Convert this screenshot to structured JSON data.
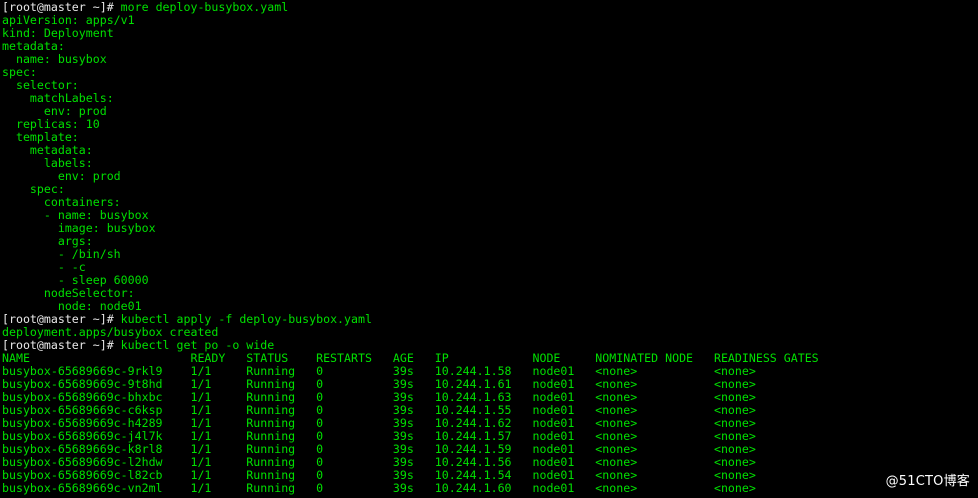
{
  "terminal": {
    "lines": [
      {
        "prompt": "[root@master ~]# ",
        "text": "more deploy-busybox.yaml"
      },
      {
        "prompt": "",
        "text": "apiVersion: apps/v1"
      },
      {
        "prompt": "",
        "text": "kind: Deployment"
      },
      {
        "prompt": "",
        "text": "metadata:"
      },
      {
        "prompt": "",
        "text": "  name: busybox"
      },
      {
        "prompt": "",
        "text": "spec:"
      },
      {
        "prompt": "",
        "text": "  selector:"
      },
      {
        "prompt": "",
        "text": "    matchLabels:"
      },
      {
        "prompt": "",
        "text": "      env: prod"
      },
      {
        "prompt": "",
        "text": "  replicas: 10"
      },
      {
        "prompt": "",
        "text": "  template:"
      },
      {
        "prompt": "",
        "text": "    metadata:"
      },
      {
        "prompt": "",
        "text": "      labels:"
      },
      {
        "prompt": "",
        "text": "        env: prod"
      },
      {
        "prompt": "",
        "text": "    spec:"
      },
      {
        "prompt": "",
        "text": "      containers:"
      },
      {
        "prompt": "",
        "text": "      - name: busybox"
      },
      {
        "prompt": "",
        "text": "        image: busybox"
      },
      {
        "prompt": "",
        "text": "        args:"
      },
      {
        "prompt": "",
        "text": "        - /bin/sh"
      },
      {
        "prompt": "",
        "text": "        - -c"
      },
      {
        "prompt": "",
        "text": "        - sleep 60000"
      },
      {
        "prompt": "",
        "text": "      nodeSelector:"
      },
      {
        "prompt": "",
        "text": "        node: node01"
      },
      {
        "prompt": "[root@master ~]# ",
        "text": "kubectl apply -f deploy-busybox.yaml"
      },
      {
        "prompt": "",
        "text": "deployment.apps/busybox created"
      },
      {
        "prompt": "[root@master ~]# ",
        "text": "kubectl get po -o wide"
      },
      {
        "prompt": "",
        "text": "NAME                       READY   STATUS    RESTARTS   AGE   IP            NODE     NOMINATED NODE   READINESS GATES"
      },
      {
        "prompt": "",
        "text": "busybox-65689669c-9rkl9    1/1     Running   0          39s   10.244.1.58   node01   <none>           <none>"
      },
      {
        "prompt": "",
        "text": "busybox-65689669c-9t8hd    1/1     Running   0          39s   10.244.1.61   node01   <none>           <none>"
      },
      {
        "prompt": "",
        "text": "busybox-65689669c-bhxbc    1/1     Running   0          39s   10.244.1.63   node01   <none>           <none>"
      },
      {
        "prompt": "",
        "text": "busybox-65689669c-c6ksp    1/1     Running   0          39s   10.244.1.55   node01   <none>           <none>"
      },
      {
        "prompt": "",
        "text": "busybox-65689669c-h4289    1/1     Running   0          39s   10.244.1.62   node01   <none>           <none>"
      },
      {
        "prompt": "",
        "text": "busybox-65689669c-j4l7k    1/1     Running   0          39s   10.244.1.57   node01   <none>           <none>"
      },
      {
        "prompt": "",
        "text": "busybox-65689669c-k8rl8    1/1     Running   0          39s   10.244.1.59   node01   <none>           <none>"
      },
      {
        "prompt": "",
        "text": "busybox-65689669c-l2hdw    1/1     Running   0          39s   10.244.1.56   node01   <none>           <none>"
      },
      {
        "prompt": "",
        "text": "busybox-65689669c-l82cb    1/1     Running   0          39s   10.244.1.54   node01   <none>           <none>"
      },
      {
        "prompt": "",
        "text": "busybox-65689669c-vn2ml    1/1     Running   0          39s   10.244.1.60   node01   <none>           <none>"
      }
    ]
  },
  "watermark": "@51CTO博客",
  "colors": {
    "background": "#000000",
    "output": "#00e000",
    "prompt": "#e8e8e8"
  }
}
